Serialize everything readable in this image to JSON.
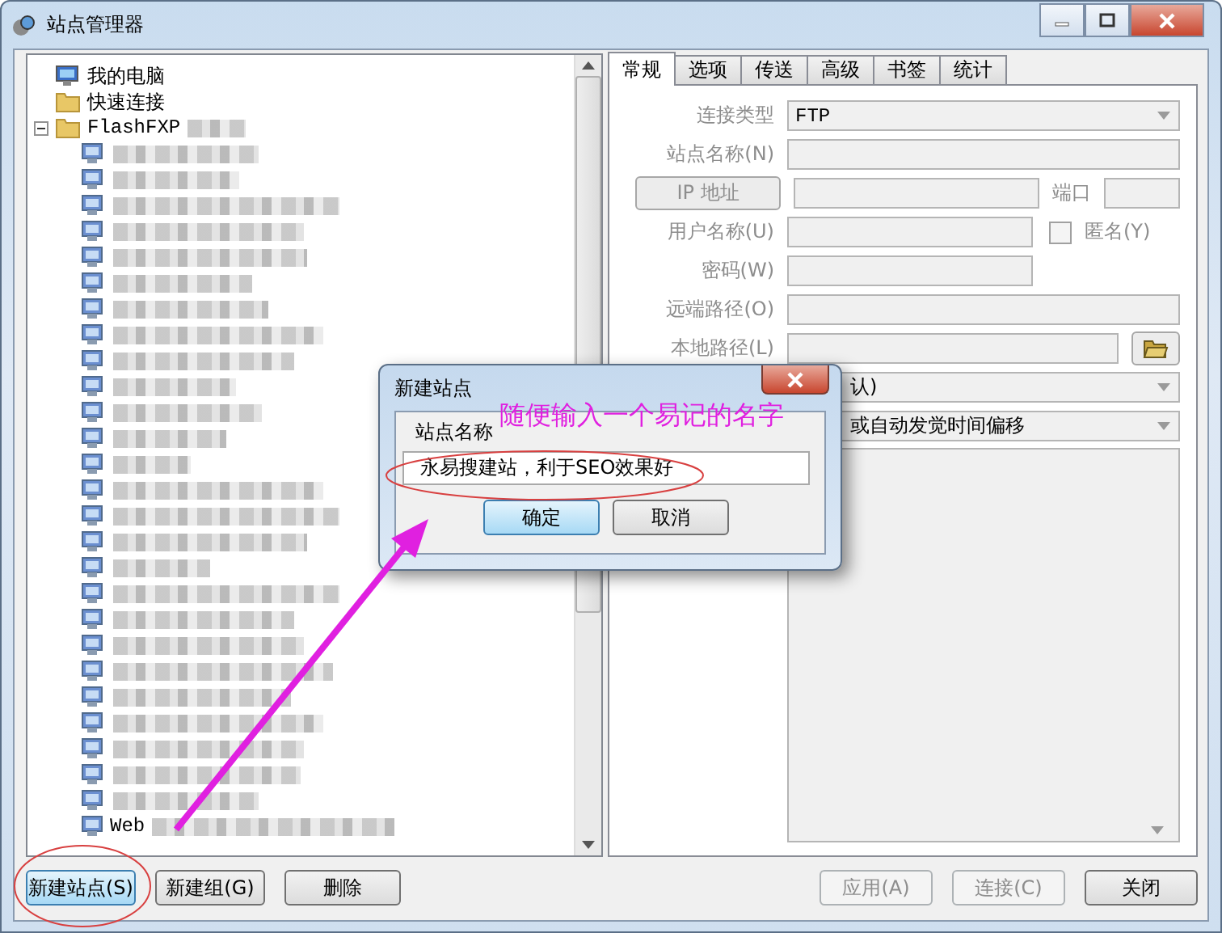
{
  "window": {
    "title": "站点管理器"
  },
  "tree": [
    {
      "kind": "computer",
      "label": "我的电脑"
    },
    {
      "kind": "folder",
      "label": "快速连接"
    },
    {
      "kind": "folder",
      "label": "FlashFXP",
      "expanded": true,
      "children": [
        {
          "kind": "site"
        },
        {
          "kind": "site"
        },
        {
          "kind": "site"
        },
        {
          "kind": "site"
        },
        {
          "kind": "site"
        },
        {
          "kind": "site"
        },
        {
          "kind": "site"
        },
        {
          "kind": "site"
        },
        {
          "kind": "site"
        },
        {
          "kind": "site"
        },
        {
          "kind": "site"
        },
        {
          "kind": "site"
        },
        {
          "kind": "site"
        },
        {
          "kind": "site"
        },
        {
          "kind": "site"
        },
        {
          "kind": "site"
        },
        {
          "kind": "site"
        },
        {
          "kind": "site"
        },
        {
          "kind": "site"
        },
        {
          "kind": "site"
        },
        {
          "kind": "site"
        },
        {
          "kind": "site"
        },
        {
          "kind": "site"
        },
        {
          "kind": "site"
        },
        {
          "kind": "site"
        },
        {
          "kind": "site"
        },
        {
          "kind": "site",
          "label": "Web"
        }
      ]
    }
  ],
  "tabs": [
    {
      "label": "常规",
      "selected": true
    },
    {
      "label": "选项",
      "selected": false
    },
    {
      "label": "传送",
      "selected": false
    },
    {
      "label": "高级",
      "selected": false
    },
    {
      "label": "书签",
      "selected": false
    },
    {
      "label": "统计",
      "selected": false
    }
  ],
  "form": {
    "disabled": true,
    "rows": [
      {
        "kind": "select",
        "label": "连接类型",
        "value": "FTP"
      },
      {
        "kind": "text",
        "label": "站点名称(N)"
      },
      {
        "kind": "ip",
        "button": "IP 地址",
        "port_label": "端口"
      },
      {
        "kind": "user",
        "label": "用户名称(U)",
        "checkbox": "匿名(Y)",
        "checked": false
      },
      {
        "kind": "short",
        "label": "密码(W)"
      },
      {
        "kind": "text",
        "label": "远端路径(O)"
      },
      {
        "kind": "browse",
        "label": "本地路径(L)"
      },
      {
        "kind": "select",
        "value": "认)"
      },
      {
        "kind": "select",
        "value": "或自动发觉时间偏移"
      },
      {
        "kind": "memo"
      }
    ]
  },
  "left_buttons": [
    {
      "label": "新建站点(S)",
      "focused": true
    },
    {
      "label": "新建组(G)",
      "focused": false
    },
    {
      "label": "删除",
      "focused": false
    }
  ],
  "right_buttons": [
    {
      "label": "应用(A)",
      "disabled": true
    },
    {
      "label": "连接(C)",
      "disabled": true
    },
    {
      "label": "关闭",
      "disabled": false
    }
  ],
  "dialog": {
    "title": "新建站点",
    "field_label": "站点名称",
    "value": "永易搜建站，利于SEO效果好",
    "buttons": [
      {
        "label": "确定",
        "default": true
      },
      {
        "label": "取消",
        "default": false
      }
    ]
  },
  "annotation": {
    "text": "随便输入一个易记的名字"
  }
}
